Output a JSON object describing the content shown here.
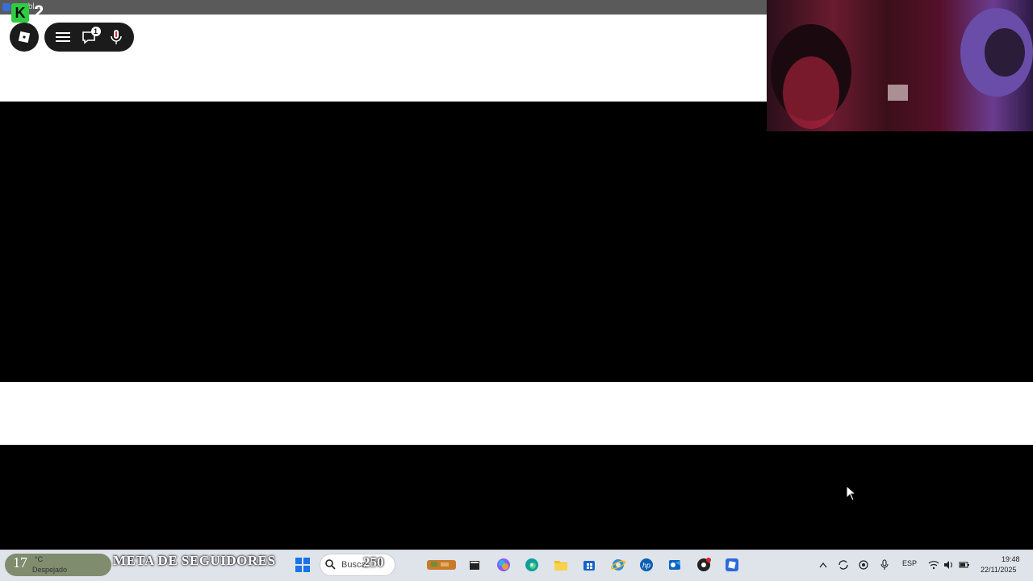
{
  "window": {
    "title": "Robl..."
  },
  "overlay": {
    "follower_count": "2",
    "k_logo": "K",
    "notification_badge": "1"
  },
  "taskbar": {
    "weather_temp": "17",
    "weather_unit": "°C",
    "weather_desc": "Despejado",
    "goal_label": "META DE SEGUIDORES",
    "search_placeholder": "Busca",
    "goal_target": "250",
    "language": "ESP",
    "time": "19:48",
    "date": "22/11/2025"
  },
  "icons": {
    "roblox": "roblox-icon",
    "menu": "hamburger-icon",
    "chat": "chat-icon",
    "mic": "microphone-icon",
    "windows": "windows-start-icon",
    "search": "search-icon"
  },
  "colors": {
    "k_green": "#2ecc40",
    "taskbar_bg": "#dfe3ea",
    "overlay_dark": "#1b1b1b",
    "webcam_red": "#6a1b2f"
  }
}
